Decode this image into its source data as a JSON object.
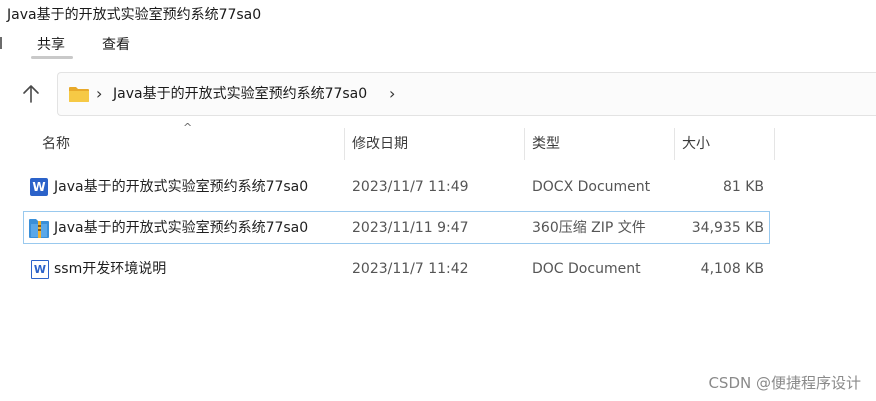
{
  "window": {
    "title": "Java基于的开放式实验室预约系统77sa0"
  },
  "ribbon": {
    "tabs": [
      "共享",
      "查看"
    ],
    "active_tab": "共享"
  },
  "address_bar": {
    "up_icon": "arrow-up-icon",
    "folder_icon": "folder-icon",
    "path": "Java基于的开放式实验室预约系统77sa0"
  },
  "columns": {
    "name": "名称",
    "date": "修改日期",
    "type": "类型",
    "size": "大小"
  },
  "files": [
    {
      "name": "Java基于的开放式实验室预约系统77sa0",
      "date": "2023/11/7 11:49",
      "type": "DOCX Document",
      "size": "81 KB",
      "icon": "word-docx-icon"
    },
    {
      "name": "Java基于的开放式实验室预约系统77sa0",
      "date": "2023/11/11 9:47",
      "type": "360压缩 ZIP 文件",
      "size": "34,935 KB",
      "icon": "zip-archive-icon"
    },
    {
      "name": "ssm开发环境说明",
      "date": "2023/11/7 11:42",
      "type": "DOC Document",
      "size": "4,108 KB",
      "icon": "word-doc-icon"
    }
  ],
  "watermark": "CSDN @便捷程序设计",
  "colors": {
    "selection_border": "#99c9ee",
    "word_blue": "#2b62c9",
    "folder_yellow": "#f6c945"
  }
}
